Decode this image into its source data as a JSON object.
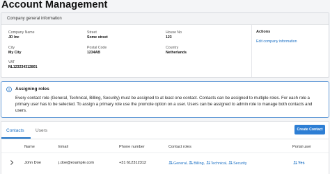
{
  "page": {
    "title": "Account Management"
  },
  "company": {
    "header": "Company general information",
    "fields": [
      {
        "label": "Company Name",
        "value": "JD Inc"
      },
      {
        "label": "Street",
        "value": "Some street"
      },
      {
        "label": "House No",
        "value": "123"
      },
      {
        "label": "City",
        "value": "My City"
      },
      {
        "label": "Postal Code",
        "value": "1234AB"
      },
      {
        "label": "Country",
        "value": "Netherlands"
      },
      {
        "label": "VAT",
        "value": "NL123234312801"
      }
    ],
    "actions_title": "Actions",
    "edit_link": "Edit company information"
  },
  "alert": {
    "title": "Assigning roles",
    "body": "Every contact role (General, Technical, Billing, Security) must be assigned to at least one contact. Contacts can be assigned to multiple roles. For each role a primary user has to be selected. To assign a primary role use the promote option on a user. Users can be assigned to admin role to manage both contacts and users."
  },
  "tabs": [
    {
      "label": "Contacts",
      "active": true
    },
    {
      "label": "Users",
      "active": false
    }
  ],
  "create_button": "Create Contact",
  "table": {
    "headers": [
      "Name",
      "Email",
      "Phone number",
      "Contact roles",
      "Portal user"
    ],
    "rows": [
      {
        "name": "John Doe",
        "email": "j.doe@example.com",
        "phone": "+31 612312312",
        "roles": [
          "General",
          "Billing",
          "Technical",
          "Security"
        ],
        "portal_user": "Yes"
      }
    ]
  },
  "colors": {
    "accent": "#1a6fc4",
    "button": "#2d7ed4",
    "alert_border": "#6a9fd8"
  }
}
